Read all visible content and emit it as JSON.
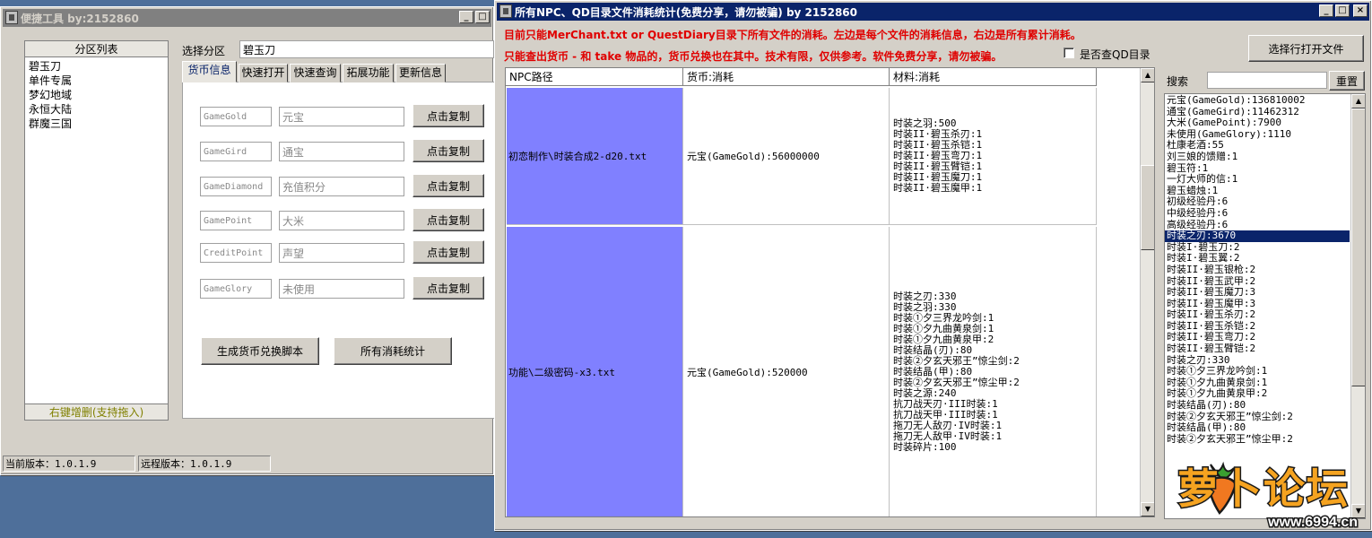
{
  "left_window": {
    "title": "便捷工具   by:2152860",
    "partition_list_header": "分区列表",
    "partitions": [
      "碧玉刀",
      "单件专属",
      "梦幻地域",
      "永恒大陆",
      "群魔三国"
    ],
    "partition_footer": "右键增删(支持拖入)",
    "select_label": "选择分区",
    "select_value": "碧玉刀",
    "tabs": [
      "货币信息",
      "快速打开",
      "快速查询",
      "拓展功能",
      "更新信息"
    ],
    "currencies": [
      {
        "code": "GameGold",
        "name": "元宝",
        "button": "点击复制"
      },
      {
        "code": "GameGird",
        "name": "通宝",
        "button": "点击复制"
      },
      {
        "code": "GameDiamond",
        "name": "充值积分",
        "button": "点击复制"
      },
      {
        "code": "GamePoint",
        "name": "大米",
        "button": "点击复制"
      },
      {
        "code": "CreditPoint",
        "name": "声望",
        "button": "点击复制"
      },
      {
        "code": "GameGlory",
        "name": "未使用",
        "button": "点击复制"
      }
    ],
    "gen_button": "生成货币兑换脚本",
    "stats_button": "所有消耗统计",
    "status_current": "当前版本：1.0.1.9",
    "status_remote": "远程版本：1.0.1.9"
  },
  "right_window": {
    "title": "所有NPC、QD目录文件消耗统计(免费分享，请勿被骗)      by 2152860",
    "notice_line1": "目前只能MerChant.txt or QuestDiary目录下所有文件的消耗。左边是每个文件的消耗信息，右边是所有累计消耗。",
    "notice_line2": "只能查出货币 - 和 take 物品的，货币兑换也在其中。技术有限，仅供参考。软件免费分享，请勿被骗。",
    "checkbox_label": "是否查QD目录",
    "open_file_button": "选择行打开文件",
    "search_label": "搜索",
    "reset_button": "重置",
    "table": {
      "headers": [
        "NPC路径",
        "货币:消耗",
        "材料:消耗"
      ],
      "rows": [
        {
          "path": "初恋制作\\时装合成2-d20.txt",
          "currency": "元宝(GameGold):56000000",
          "materials": [
            "时装之羽:500",
            "时装II·碧玉杀刃:1",
            "时装II·碧玉杀铠:1",
            "时装II·碧玉弯刀:1",
            "时装II·碧玉臂铠:1",
            "时装II·碧玉魔刀:1",
            "时装II·碧玉魔甲:1"
          ]
        },
        {
          "path": "功能\\二级密码-x3.txt",
          "currency": "元宝(GameGold):520000",
          "materials": [
            "时装之刃:330",
            "时装之羽:330",
            "时装①夕三界龙吟剑:1",
            "时装①夕九曲黄泉剑:1",
            "时装①夕九曲黄泉甲:2",
            "时装结晶(刃):80",
            "时装②夕玄天邪王”惊尘剑:2",
            "时装结晶(甲):80",
            "时装②夕玄天邪王”惊尘甲:2",
            "时装之源:240",
            "抗刀战天刃·III时装:1",
            "抗刀战天甲·III时装:1",
            "拖刀无人敌刃·IV时装:1",
            "拖刀无人敌甲·IV时装:1",
            "时装碎片:100"
          ]
        }
      ]
    },
    "totals": [
      "元宝(GameGold):136810002",
      "通宝(GameGird):11462312",
      "大米(GamePoint):7900",
      "未使用(GameGlory):1110",
      "杜康老酒:55",
      "刘三娘的馈赠:1",
      "碧玉符:1",
      "一灯大师的信:1",
      "碧玉蜡烛:1",
      "初级经验丹:6",
      "中级经验丹:6",
      "高级经验丹:6",
      "时装之刃:3670",
      "时装I·碧玉刀:2",
      "时装I·碧玉翼:2",
      "时装II·碧玉银枪:2",
      "时装II·碧玉武甲:2",
      "时装II·碧玉魔刀:3",
      "时装II·碧玉魔甲:3",
      "时装II·碧玉杀刃:2",
      "时装II·碧玉杀铠:2",
      "时装II·碧玉弯刀:2",
      "时装II·碧玉臂铠:2",
      "时装之刃:330",
      "时装①夕三界龙吟剑:1",
      "时装①夕九曲黄泉剑:1",
      "时装①夕九曲黄泉甲:2",
      "时装结晶(刃):80",
      "时装②夕玄天邪王”惊尘剑:2",
      "时装结晶(甲):80",
      "时装②夕玄天邪王”惊尘甲:2"
    ],
    "selected_total_index": 12
  },
  "watermark": {
    "text": "萝卜论坛",
    "url": "www.6994.cn"
  }
}
